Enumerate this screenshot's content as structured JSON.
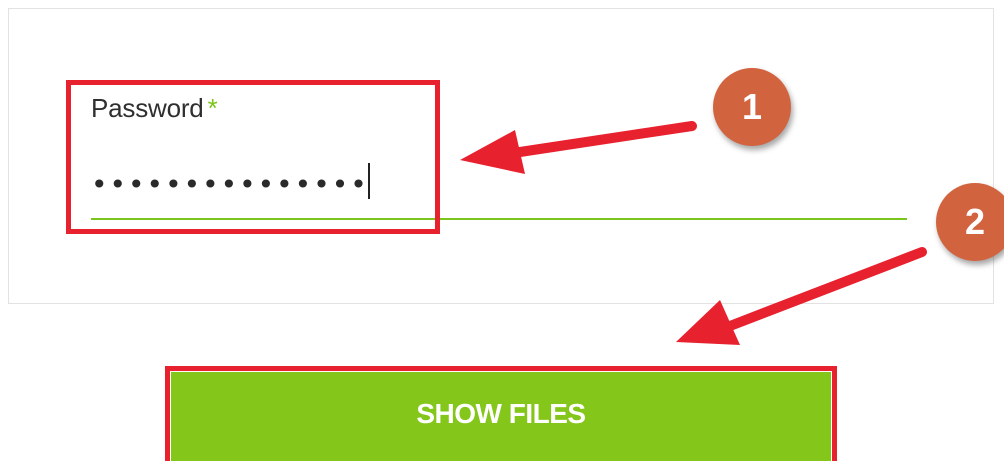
{
  "form": {
    "password_label": "Password",
    "required_marker": "*",
    "password_value": "•••••••••••••••"
  },
  "actions": {
    "show_files_label": "SHOW FILES"
  },
  "annotations": {
    "step_1": "1",
    "step_2": "2"
  },
  "colors": {
    "accent_green": "#84c61a",
    "underline_green": "#7ac41b",
    "annotation_red": "#e8212f",
    "badge_orange": "#d2633f"
  }
}
